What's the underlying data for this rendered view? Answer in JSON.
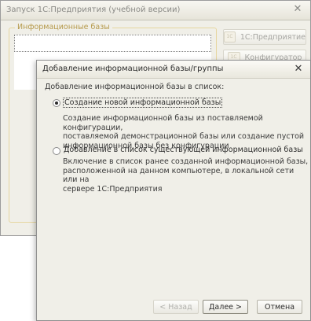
{
  "background_window": {
    "title": "Запуск 1С:Предприятия (учебной версии)",
    "close_glyph": "✕",
    "group_title": "Информационные базы",
    "buttons": {
      "enterprise": "1С:Предприятие",
      "configurator": "Конфигуратор"
    }
  },
  "dialog": {
    "title": "Добавление информационной базы/группы",
    "close_glyph": "✕",
    "prompt": "Добавление информационной базы в список:",
    "options": [
      {
        "label": "Создание новой информационной базы",
        "selected": true,
        "description": [
          "Создание информационной базы из поставляемой конфигурации,",
          "поставляемой демонстрационной базы или создание пустой",
          "информационной базы без конфигурации"
        ]
      },
      {
        "label": "Добавление в список существующей информационной базы",
        "selected": false,
        "description": [
          "Включение в список ранее созданной информационной базы,",
          "расположенной на данном компьютере,  в локальной сети или на",
          "сервере 1С:Предприятия"
        ]
      }
    ],
    "buttons": {
      "back": "< Назад",
      "next": "Далее >",
      "cancel": "Отмена"
    }
  }
}
